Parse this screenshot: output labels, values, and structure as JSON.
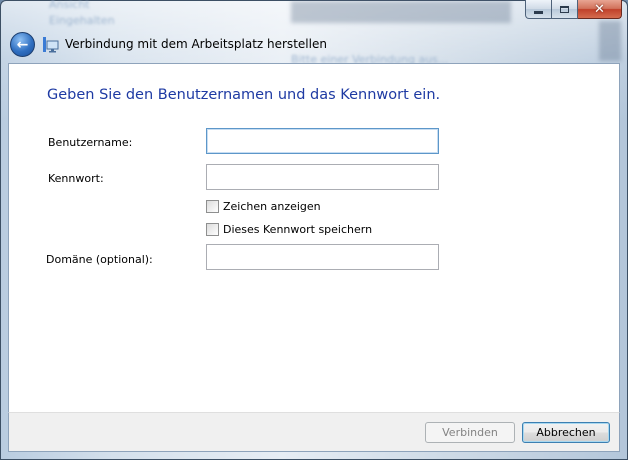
{
  "window": {
    "title": "Verbindung mit dem Arbeitsplatz herstellen",
    "background_texts": [
      "Ansicht",
      "Eingehalten",
      "Eigenschaften",
      "Bitte einer Verbindung aus..."
    ]
  },
  "form": {
    "heading": "Geben Sie den Benutzernamen und das Kennwort ein.",
    "username_label": "Benutzername:",
    "username_value": "",
    "password_label": "Kennwort:",
    "password_value": "",
    "show_chars_label": "Zeichen anzeigen",
    "show_chars_checked": false,
    "remember_label": "Dieses Kennwort speichern",
    "remember_checked": false,
    "domain_label": "Domäne (optional):",
    "domain_value": ""
  },
  "footer": {
    "connect_label": "Verbinden",
    "cancel_label": "Abbrechen"
  },
  "colors": {
    "heading": "#1e3aa3",
    "close_button": "#c0402a",
    "back_button": "#2f6fc1"
  }
}
